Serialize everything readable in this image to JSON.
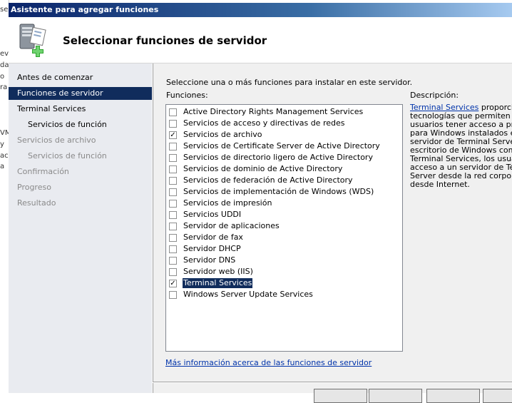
{
  "window": {
    "title": "Asistente para agregar funciones"
  },
  "header": {
    "title": "Seleccionar funciones de servidor",
    "icon": "server-add-icon"
  },
  "background_fragments": [
    "se",
    "ev",
    "da",
    "o",
    "ra",
    "VM",
    "y",
    "ac",
    "a"
  ],
  "sidebar": {
    "items": [
      {
        "label": "Antes de comenzar",
        "state": "normal",
        "level": 0
      },
      {
        "label": "Funciones de servidor",
        "state": "selected",
        "level": 0
      },
      {
        "label": "Terminal Services",
        "state": "normal",
        "level": 0
      },
      {
        "label": "Servicios de función",
        "state": "normal",
        "level": 1
      },
      {
        "label": "Servicios de archivo",
        "state": "disabled",
        "level": 0
      },
      {
        "label": "Servicios de función",
        "state": "disabled",
        "level": 1
      },
      {
        "label": "Confirmación",
        "state": "disabled",
        "level": 0
      },
      {
        "label": "Progreso",
        "state": "disabled",
        "level": 0
      },
      {
        "label": "Resultado",
        "state": "disabled",
        "level": 0
      }
    ]
  },
  "main": {
    "instruction": "Seleccione una o más funciones para instalar en este servidor.",
    "roles_label": "Funciones:",
    "roles": [
      {
        "label": "Active Directory Rights Management Services",
        "checked": false,
        "selected": false
      },
      {
        "label": "Servicios de acceso y directivas de redes",
        "checked": false,
        "selected": false
      },
      {
        "label": "Servicios de archivo",
        "checked": true,
        "selected": false
      },
      {
        "label": "Servicios de Certificate Server de Active Directory",
        "checked": false,
        "selected": false
      },
      {
        "label": "Servicios de directorio ligero de Active Directory",
        "checked": false,
        "selected": false
      },
      {
        "label": "Servicios de dominio de Active Directory",
        "checked": false,
        "selected": false
      },
      {
        "label": "Servicios de federación de Active Directory",
        "checked": false,
        "selected": false
      },
      {
        "label": "Servicios de implementación de Windows (WDS)",
        "checked": false,
        "selected": false
      },
      {
        "label": "Servicios de impresión",
        "checked": false,
        "selected": false
      },
      {
        "label": "Servicios UDDI",
        "checked": false,
        "selected": false
      },
      {
        "label": "Servidor de aplicaciones",
        "checked": false,
        "selected": false
      },
      {
        "label": "Servidor de fax",
        "checked": false,
        "selected": false
      },
      {
        "label": "Servidor DHCP",
        "checked": false,
        "selected": false
      },
      {
        "label": "Servidor DNS",
        "checked": false,
        "selected": false
      },
      {
        "label": "Servidor web (IIS)",
        "checked": false,
        "selected": false
      },
      {
        "label": "Terminal Services",
        "checked": true,
        "selected": true
      },
      {
        "label": "Windows Server Update Services",
        "checked": false,
        "selected": false
      }
    ],
    "description_title": "Descripción:",
    "description_link": "Terminal Services",
    "description_first_line_rest": " proporcion",
    "description_lines": [
      "tecnologías que permiten a l",
      "usuarios tener acceso a prog",
      "para Windows instalados en",
      "servidor de Terminal Server",
      "escritorio de Windows compl",
      "Terminal Services, los usuari",
      "acceso a un servidor de Term",
      "Server desde la red corporat",
      "desde Internet."
    ],
    "more_info_link": "Más información acerca de las funciones de servidor"
  },
  "colors": {
    "selection": "#102c5c",
    "sidebar_bg": "#e9ebf0",
    "content_bg": "#f0f0f0",
    "link": "#0033aa",
    "titlebar_start": "#0a246a"
  }
}
